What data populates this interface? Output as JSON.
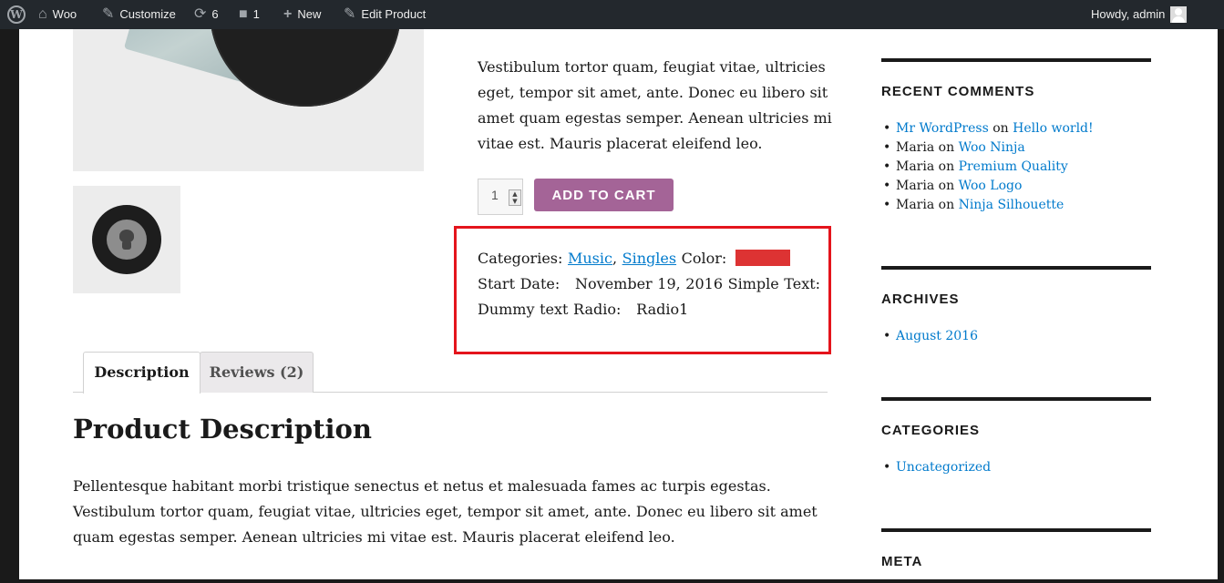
{
  "admin_bar": {
    "site": "Woo",
    "customize": "Customize",
    "updates_count": "6",
    "comments_count": "1",
    "new": "New",
    "edit": "Edit Product",
    "greeting": "Howdy, admin"
  },
  "product": {
    "summary": "Vestibulum tortor quam, feugiat vitae, ultricies eget, tempor sit amet, ante. Donec eu libero sit amet quam egestas semper. Aenean ultricies mi vitae est. Mauris placerat eleifend leo.",
    "quantity": "1",
    "add_to_cart": "ADD TO CART",
    "meta": {
      "categories_label": "Categories:",
      "categories": [
        "Music",
        "Singles"
      ],
      "color_label": "Color:",
      "color_value": "#dd3333",
      "start_date_label": "Start Date:",
      "start_date": "November 19, 2016",
      "simple_text_label": "Simple Text:",
      "simple_text": "Dummy text",
      "radio_label": "Radio:",
      "radio": "Radio1"
    },
    "highlight_color": "#e4141c"
  },
  "tabs": [
    {
      "label": "Description"
    },
    {
      "label": "Reviews (2)"
    }
  ],
  "description": {
    "heading": "Product Description",
    "text": "Pellentesque habitant morbi tristique senectus et netus et malesuada fames ac turpis egestas. Vestibulum tortor quam, feugiat vitae, ultricies eget, tempor sit amet, ante. Donec eu libero sit amet quam egestas semper. Aenean ultricies mi vitae est. Mauris placerat eleifend leo."
  },
  "sidebar": {
    "recent_comments": {
      "title": "RECENT COMMENTS",
      "items": [
        {
          "author": "Mr WordPress",
          "on": "on",
          "post": "Hello world!",
          "author_link": true
        },
        {
          "author": "Maria",
          "on": "on",
          "post": "Woo Ninja",
          "author_link": false
        },
        {
          "author": "Maria",
          "on": "on",
          "post": "Premium Quality",
          "author_link": false
        },
        {
          "author": "Maria",
          "on": "on",
          "post": "Woo Logo",
          "author_link": false
        },
        {
          "author": "Maria",
          "on": "on",
          "post": "Ninja Silhouette",
          "author_link": false
        }
      ]
    },
    "archives": {
      "title": "ARCHIVES",
      "items": [
        "August 2016"
      ]
    },
    "categories": {
      "title": "CATEGORIES",
      "items": [
        "Uncategorized"
      ]
    },
    "meta": {
      "title": "META"
    }
  }
}
